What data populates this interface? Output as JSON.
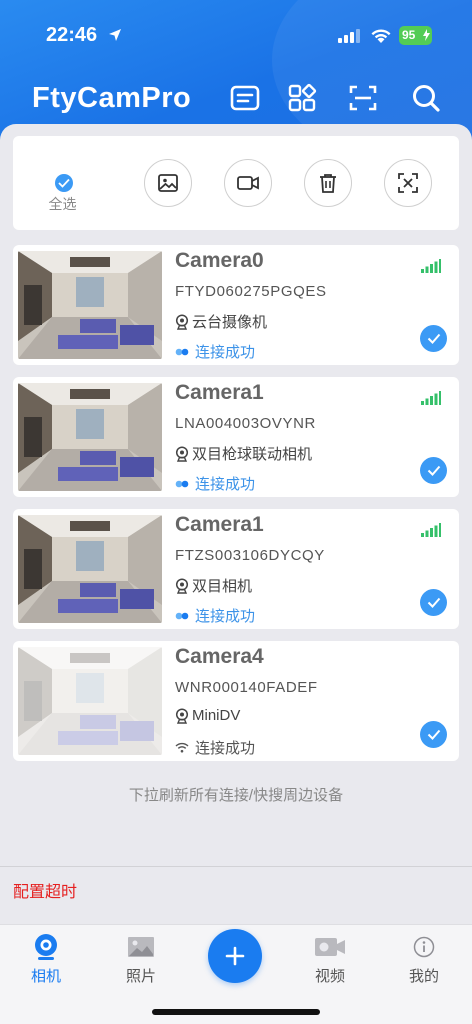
{
  "status_bar": {
    "time": "22:46",
    "battery": "95"
  },
  "header": {
    "title": "FtyCamPro"
  },
  "toolbar": {
    "select_all_label": "全选"
  },
  "cameras": [
    {
      "name": "Camera0",
      "id": "FTYD060275PGQES",
      "type": "云台摄像机",
      "status": "连接成功",
      "connection": "p2p",
      "checked": true
    },
    {
      "name": "Camera1",
      "id": "LNA004003OVYNR",
      "type": "双目枪球联动相机",
      "status": "连接成功",
      "connection": "p2p",
      "checked": true
    },
    {
      "name": "Camera1",
      "id": "FTZS003106DYCQY",
      "type": "双目相机",
      "status": "连接成功",
      "connection": "p2p",
      "checked": true
    },
    {
      "name": "Camera4",
      "id": "WNR000140FADEF",
      "type": "MiniDV",
      "status": "连接成功",
      "connection": "wifi",
      "checked": true
    }
  ],
  "pull_hint": "下拉刷新所有连接/快搜周边设备",
  "config_timeout": "配置超时",
  "bottom_nav": {
    "items": [
      {
        "label": "相机",
        "icon": "camera-icon",
        "active": true
      },
      {
        "label": "照片",
        "icon": "photo-icon",
        "active": false
      },
      {
        "label": "",
        "icon": "plus-icon",
        "active": false
      },
      {
        "label": "视频",
        "icon": "video-icon",
        "active": false
      },
      {
        "label": "我的",
        "icon": "info-icon",
        "active": false
      }
    ]
  },
  "colors": {
    "brand": "#1a7cf0",
    "header_gradient_start": "#2a8bf0",
    "status_blue": "#3d93e8",
    "check_blue": "#3b9af5",
    "error_red": "#e52020",
    "signal_green": "#35c06a"
  }
}
